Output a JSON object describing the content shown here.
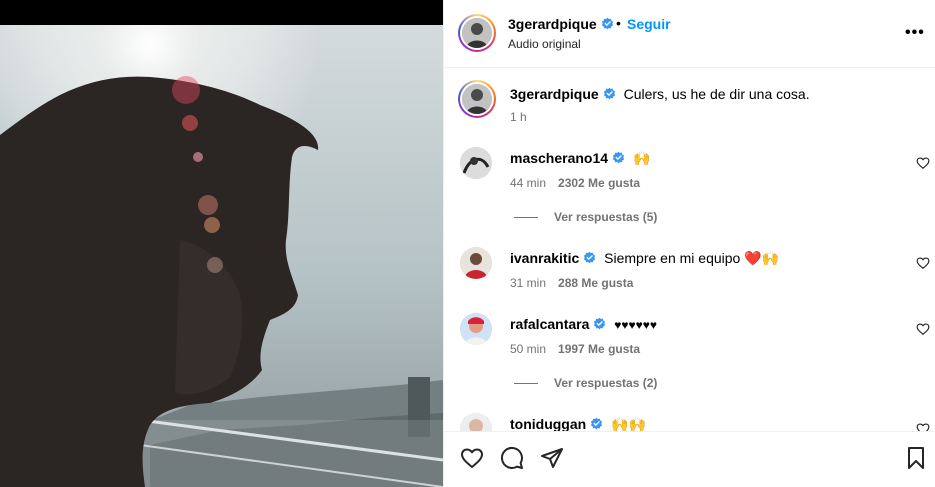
{
  "header": {
    "username": "3gerardpique",
    "follow_label": "Seguir",
    "dot": "•",
    "audio": "Audio original",
    "more": "•••"
  },
  "caption": {
    "username": "3gerardpique",
    "text": "Culers, us he de dir una cosa.",
    "time": "1 h"
  },
  "comments": [
    {
      "username": "mascherano14",
      "text": "🙌",
      "time": "44 min",
      "likes": "2302 Me gusta",
      "replies": "Ver respuestas (5)"
    },
    {
      "username": "ivanrakitic",
      "text": "Siempre en mi equipo ❤️🙌",
      "time": "31 min",
      "likes": "288 Me gusta",
      "replies": ""
    },
    {
      "username": "rafalcantara",
      "text": "♥♥♥♥♥♥",
      "time": "50 min",
      "likes": "1997 Me gusta",
      "replies": "Ver respuestas (2)"
    },
    {
      "username": "toniduggan",
      "text": "🙌🙌",
      "time": "",
      "likes": "",
      "replies": ""
    }
  ],
  "icons": {
    "like": "heart-icon",
    "comment": "comment-icon",
    "share": "share-icon",
    "save": "bookmark-icon"
  },
  "colors": {
    "link": "#0095f6",
    "verified": "#3897f0",
    "muted": "#737373"
  }
}
